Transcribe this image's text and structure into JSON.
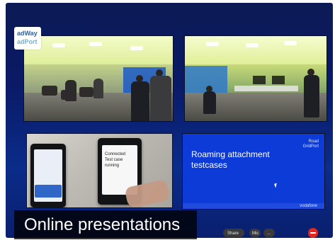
{
  "overlay": {
    "logo_line1": "adWay",
    "logo_line2": "adPort",
    "caption": "Online presentations"
  },
  "slide": {
    "title_line1": "Roaming attachment",
    "title_line2": "testcases",
    "logo_line1": "Road",
    "logo_line2": "GridPort",
    "brand": "vodafone"
  },
  "phone": {
    "screen_text": [
      "Connected",
      "Test case",
      "running"
    ]
  },
  "taskbar": {
    "share_label": "Share",
    "more_label": "...",
    "mic_label": "Mic"
  },
  "colors": {
    "slide_bg": "#0d3bd8",
    "caption_bg": "#000000",
    "end_call": "#e3261f"
  }
}
